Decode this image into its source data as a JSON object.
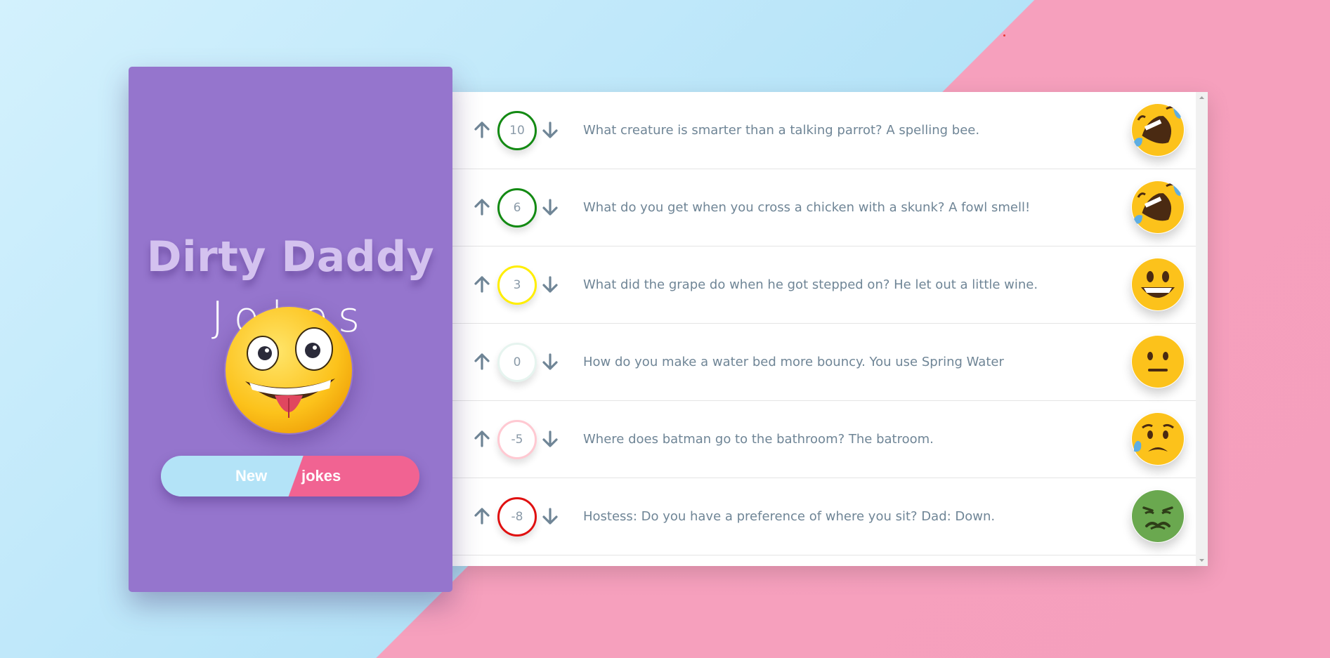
{
  "app": {
    "title_main": "Dirty Daddy",
    "title_sub": "Jokes"
  },
  "button": {
    "left_label": "New",
    "right_label": "jokes"
  },
  "jokes": [
    {
      "score": "10",
      "text": "What creature is smarter than a talking parrot? A spelling bee.",
      "score_color": "#138a13",
      "emoji": "rolling-on-floor-laughing"
    },
    {
      "score": "6",
      "text": "What do you get when you cross a chicken with a skunk? A fowl smell!",
      "score_color": "#138a13",
      "emoji": "rolling-on-floor-laughing"
    },
    {
      "score": "3",
      "text": "What did the grape do when he got stepped on? He let out a little wine.",
      "score_color": "#ffee00",
      "emoji": "grinning-face"
    },
    {
      "score": "0",
      "text": "How do you make a water bed more bouncy. You use Spring Water",
      "score_color": "#e6f4ef",
      "emoji": "neutral-face"
    },
    {
      "score": "-5",
      "text": "Where does batman go to the bathroom? The batroom.",
      "score_color": "#ffc9d2",
      "emoji": "sad-sweat-face"
    },
    {
      "score": "-8",
      "text": "Hostess: Do you have a preference of where you sit? Dad: Down.",
      "score_color": "#e01010",
      "emoji": "nauseated-face"
    }
  ],
  "colors": {
    "card": "#9575cd",
    "arrow": "#6f8596"
  }
}
